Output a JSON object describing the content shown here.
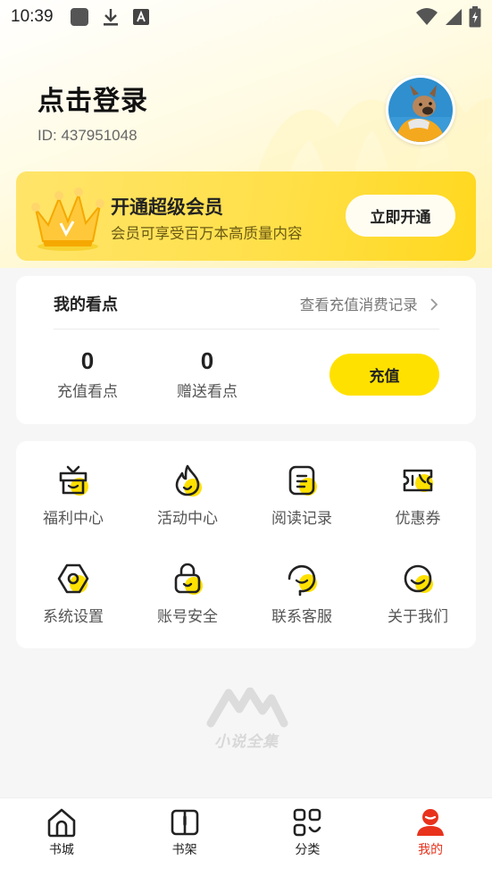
{
  "status_bar": {
    "time": "10:39",
    "icons_left": [
      "app-notification-icon",
      "download-icon",
      "font-a-icon"
    ],
    "icons_right": [
      "wifi-icon",
      "signal-icon",
      "battery-charging-icon"
    ]
  },
  "profile": {
    "login_title": "点击登录",
    "user_id": "ID: 437951048",
    "avatar": "dog-avatar"
  },
  "vip": {
    "title": "开通超级会员",
    "subtitle": "会员可享受百万本高质量内容",
    "button": "立即开通",
    "icon": "crown-icon"
  },
  "points": {
    "title": "我的看点",
    "records_link": "查看充值消费记录",
    "recharge_points": {
      "value": "0",
      "label": "充值看点"
    },
    "gift_points": {
      "value": "0",
      "label": "赠送看点"
    },
    "recharge_button": "充值"
  },
  "menu": [
    {
      "label": "福利中心",
      "icon": "gift-box-icon"
    },
    {
      "label": "活动中心",
      "icon": "flame-icon"
    },
    {
      "label": "阅读记录",
      "icon": "reading-record-icon"
    },
    {
      "label": "优惠券",
      "icon": "coupon-icon"
    },
    {
      "label": "系统设置",
      "icon": "settings-icon"
    },
    {
      "label": "账号安全",
      "icon": "lock-icon"
    },
    {
      "label": "联系客服",
      "icon": "customer-service-icon"
    },
    {
      "label": "关于我们",
      "icon": "about-icon"
    }
  ],
  "watermark": {
    "text": "小说全集",
    "icon": "mountain-logo"
  },
  "tabbar": [
    {
      "label": "书城",
      "icon": "home-icon",
      "active": false
    },
    {
      "label": "书架",
      "icon": "bookshelf-icon",
      "active": false
    },
    {
      "label": "分类",
      "icon": "category-icon",
      "active": false
    },
    {
      "label": "我的",
      "icon": "profile-icon",
      "active": true
    }
  ],
  "colors": {
    "accent_yellow": "#ffe100",
    "active_red": "#e8321c",
    "icon_dark": "#222222"
  }
}
